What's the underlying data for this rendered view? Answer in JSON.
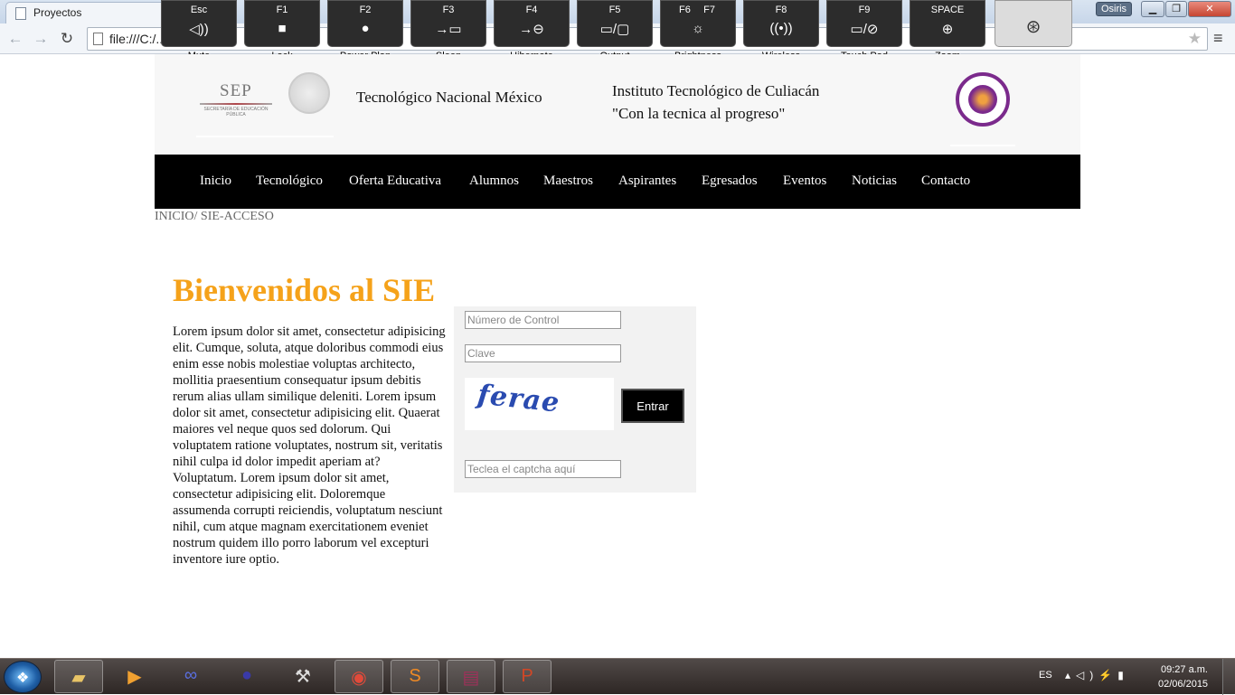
{
  "browser": {
    "tab_title": "Proyectos",
    "address": "file:///C:/...",
    "user_badge": "Osiris",
    "window_buttons": {
      "minimize": "▁",
      "maximize": "❐",
      "close": "✕"
    }
  },
  "fn_keys": [
    {
      "key": "Esc",
      "label": "Mute",
      "glyph": "◁))",
      "icon": "mute-icon"
    },
    {
      "key": "F1",
      "label": "Lock",
      "glyph": "🔒",
      "icon": "lock-icon"
    },
    {
      "key": "F2",
      "label": "Power Plan",
      "glyph": "●",
      "icon": "power-plan-icon"
    },
    {
      "key": "F3",
      "label": "Sleep",
      "glyph": "→▭",
      "icon": "sleep-icon"
    },
    {
      "key": "F4",
      "label": "Hibernate",
      "glyph": "→⊖",
      "icon": "hibernate-icon"
    },
    {
      "key": "F5",
      "label": "Output",
      "glyph": "▭/▢",
      "icon": "output-icon"
    },
    {
      "key": "F6",
      "key2": "F7",
      "label": "Brightness",
      "glyph": "☼",
      "icon": "brightness-icon"
    },
    {
      "key": "F8",
      "label": "Wireless",
      "glyph": "((•))",
      "icon": "wireless-icon"
    },
    {
      "key": "F9",
      "label": "Touch Pad",
      "glyph": "▭/⊘",
      "icon": "touchpad-icon"
    },
    {
      "key": "SPACE",
      "label": "Zoom",
      "glyph": "⊕",
      "icon": "zoom-icon"
    }
  ],
  "header": {
    "sep_logo": "SEP",
    "sep_subtitle": "SECRETARÍA DE EDUCACIÓN PÚBLICA",
    "tecnm_title": "Tecnológico Nacional México",
    "institute_name": "Instituto Tecnológico de Culiacán",
    "institute_motto": "\"Con la tecnica al progreso\""
  },
  "nav": {
    "items": [
      "Inicio",
      "Tecnológico",
      "Oferta Educativa",
      "Alumnos",
      "Maestros",
      "Aspirantes",
      "Egresados",
      "Eventos",
      "Noticias",
      "Contacto"
    ]
  },
  "breadcrumb": "INICIO/ SIE-ACCESO",
  "main": {
    "title": "Bienvenidos al SIE",
    "intro": "Lorem ipsum dolor sit amet, consectetur adipisicing elit. Cumque, soluta, atque doloribus commodi eius enim esse nobis molestiae voluptas architecto, mollitia praesentium consequatur ipsum debitis rerum alias ullam similique deleniti. Lorem ipsum dolor sit amet, consectetur adipisicing elit. Quaerat maiores vel neque quos sed dolorum. Qui voluptatem ratione voluptates, nostrum sit, veritatis nihil culpa id dolor impedit aperiam at? Voluptatum. Lorem ipsum dolor sit amet, consectetur adipisicing elit. Doloremque assumenda corrupti reiciendis, voluptatum nesciunt nihil, cum atque magnam exercitationem eveniet nostrum quidem illo porro laborum vel excepturi inventore iure optio."
  },
  "login": {
    "control_placeholder": "Número de Control",
    "password_placeholder": "Clave",
    "captcha_image_text": "ferae",
    "captcha_placeholder": "Teclea el captcha aquí",
    "submit_label": "Entrar"
  },
  "taskbar": {
    "apps": [
      "file-explorer",
      "media-player",
      "infinity-app",
      "eclipse",
      "tools",
      "chrome",
      "sublime",
      "winrar",
      "powerpoint"
    ],
    "language": "ES",
    "time": "09:27 a.m.",
    "date": "02/06/2015"
  },
  "colors": {
    "accent_title": "#f5a21a",
    "nav_bg": "#000000",
    "itc_purple": "#7b2a8c"
  }
}
